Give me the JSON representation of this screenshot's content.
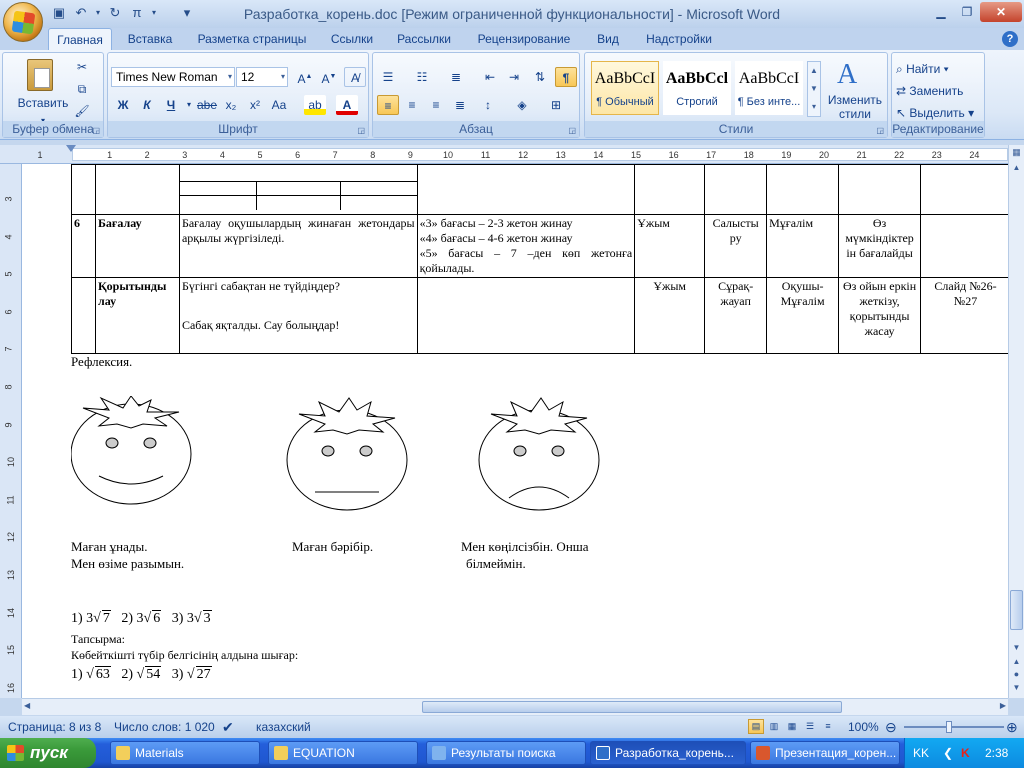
{
  "window": {
    "title": "Разработка_корень.doc [Режим ограниченной функциональности] - Microsoft Word"
  },
  "tabs": [
    "Главная",
    "Вставка",
    "Разметка страницы",
    "Ссылки",
    "Рассылки",
    "Рецензирование",
    "Вид",
    "Надстройки"
  ],
  "ribbon": {
    "clipboard": {
      "label": "Буфер обмена",
      "paste": "Вставить"
    },
    "font": {
      "label": "Шрифт",
      "name": "Times New Roman",
      "size": "12",
      "bold": "Ж",
      "italic": "К",
      "underline": "Ч",
      "strike": "abe",
      "subscript": "x₂",
      "superscript": "x²",
      "case": "Aa"
    },
    "paragraph": {
      "label": "Абзац"
    },
    "styles": {
      "label": "Стили",
      "items": [
        {
          "preview": "AaBbCcI",
          "name": "¶ Обычный"
        },
        {
          "preview": "AaBbCcl",
          "name": "Строгий"
        },
        {
          "preview": "AaBbCcI",
          "name": "¶ Без инте..."
        }
      ],
      "change": "Изменить стили"
    },
    "editing": {
      "label": "Редактирование",
      "find": "Найти",
      "replace": "Заменить",
      "select": "Выделить"
    }
  },
  "ruler": {
    "h_numbers": [
      "1",
      "1",
      "2",
      "3",
      "4",
      "5",
      "6",
      "7",
      "8",
      "9",
      "10",
      "11",
      "12",
      "13",
      "14",
      "15",
      "16",
      "17",
      "18",
      "19",
      "20",
      "21",
      "22",
      "23",
      "24"
    ],
    "v_numbers": [
      "3",
      "4",
      "5",
      "6",
      "7",
      "8",
      "9",
      "10",
      "11",
      "12",
      "13",
      "14",
      "15",
      "16"
    ]
  },
  "table": {
    "row6": {
      "num": "6",
      "stage": "Бағалау",
      "content": "Бағалау оқушылардың жинаған жетондары арқылы жүргізіледі.",
      "criteria": [
        "«3» бағасы – 2-3 жетон жинау",
        "«4» бағасы – 4-6 жетон жинау",
        "«5» бағасы – 7 –ден көп жетонға қойылады."
      ],
      "form": "Ұжым",
      "method": "Салысты ру",
      "role": "Мұғалім",
      "goal": "Өз мүмкіндіктер ін бағалайды",
      "resource": ""
    },
    "row7": {
      "stage": "Қорытынды лау",
      "content1": "Бүгінгі сабақтан не түйдіңдер?",
      "content2": "Сабақ яқталды. Сау болыңдар!",
      "form": "Ұжым",
      "method": "Сұрақ-жауап",
      "role": "Оқушы-Мұғалім",
      "goal": "Өз ойын еркін жеткізу, қорытынды жасау",
      "resource": "Слайд №26-№27"
    }
  },
  "reflection": {
    "heading": "Рефлексия.",
    "faces": [
      {
        "caption1": "Маған ұнады.",
        "caption2": "Мен өзіме разымын.",
        "mood": "happy"
      },
      {
        "caption1": "Маған бәрібір.",
        "caption2": "",
        "mood": "neutral"
      },
      {
        "caption1": "Мен көңілсізбін. Онша",
        "caption2": "білмеймін.",
        "mood": "sad"
      }
    ]
  },
  "math": {
    "line1": [
      {
        "n": "1)",
        "coef": "3",
        "rad": "7"
      },
      {
        "n": "2)",
        "coef": "3",
        "rad": "6"
      },
      {
        "n": "3)",
        "coef": "3",
        "rad": "3"
      }
    ],
    "task_label": "Тапсырма:",
    "task_text": "Көбейткішті түбір белгісінің алдына шығар:",
    "line2": [
      {
        "n": "1)",
        "rad": "63"
      },
      {
        "n": "2)",
        "rad": "54"
      },
      {
        "n": "3)",
        "rad": "27"
      }
    ]
  },
  "status": {
    "page": "Страница: 8 из 8",
    "words": "Число слов: 1 020",
    "lang": "казахский",
    "zoom": "100%"
  },
  "taskbar": {
    "start": "пуск",
    "items": [
      "Materials",
      "EQUATION",
      "Результаты поиска",
      "Разработка_корень...",
      "Презентация_корен..."
    ],
    "lang": "KK",
    "time": "2:38"
  }
}
